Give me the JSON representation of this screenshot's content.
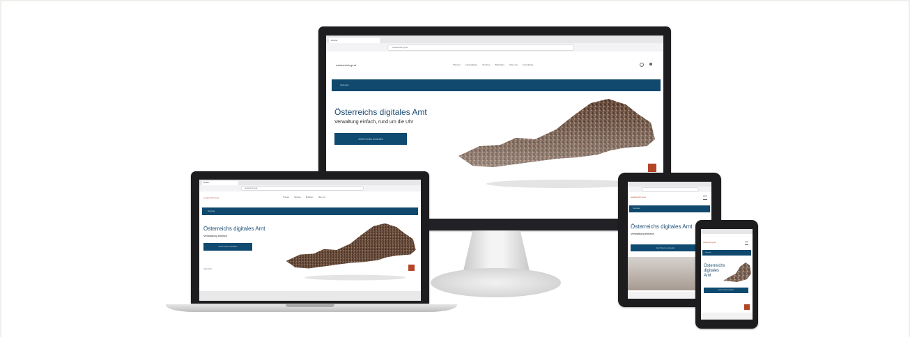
{
  "desktop": {
    "tab_title": "BMDW",
    "url": "oesterreich.gv.at",
    "logo": "oesterreich.gv.at",
    "nav": [
      "Themen",
      "Lebenslagen",
      "Services",
      "Behörden",
      "Über uns",
      "Anmeldung"
    ],
    "banner": "Startseite",
    "hero_title": "Österreichs digitales Amt",
    "hero_subtitle": "Verwaltung einfach, rund um die Uhr",
    "cta": "Jetzt Konto erstellen"
  },
  "laptop": {
    "tab_title": "BMDW",
    "url": "oesterreich.gv.at",
    "logo": "oesterreich.gv.at",
    "nav": [
      "Themen",
      "Services",
      "Behörden",
      "Über uns"
    ],
    "banner": "Startseite",
    "hero_title": "Österreichs digitales Amt",
    "hero_subtitle": "Verwaltung einfach",
    "cta": "Jetzt Konto erstellen",
    "footer_text": "Aktuelles"
  },
  "tablet": {
    "logo": "oesterreich.gv.at",
    "banner": "Startseite",
    "hero_title": "Österreichs digitales Amt",
    "hero_subtitle": "Verwaltung einfach",
    "cta": "Jetzt Konto erstellen"
  },
  "phone": {
    "logo": "oesterreich.gv.at",
    "banner": "Startseite",
    "hero_title": "Österreichs digitales Amt",
    "cta": "Jetzt Konto erstellen"
  },
  "colors": {
    "brand": "#10496d",
    "accent": "#b44628",
    "heading": "#1c4c72"
  },
  "icons": [
    "austria-map-crowd-icon",
    "search-icon",
    "user-icon",
    "menu-icon"
  ]
}
